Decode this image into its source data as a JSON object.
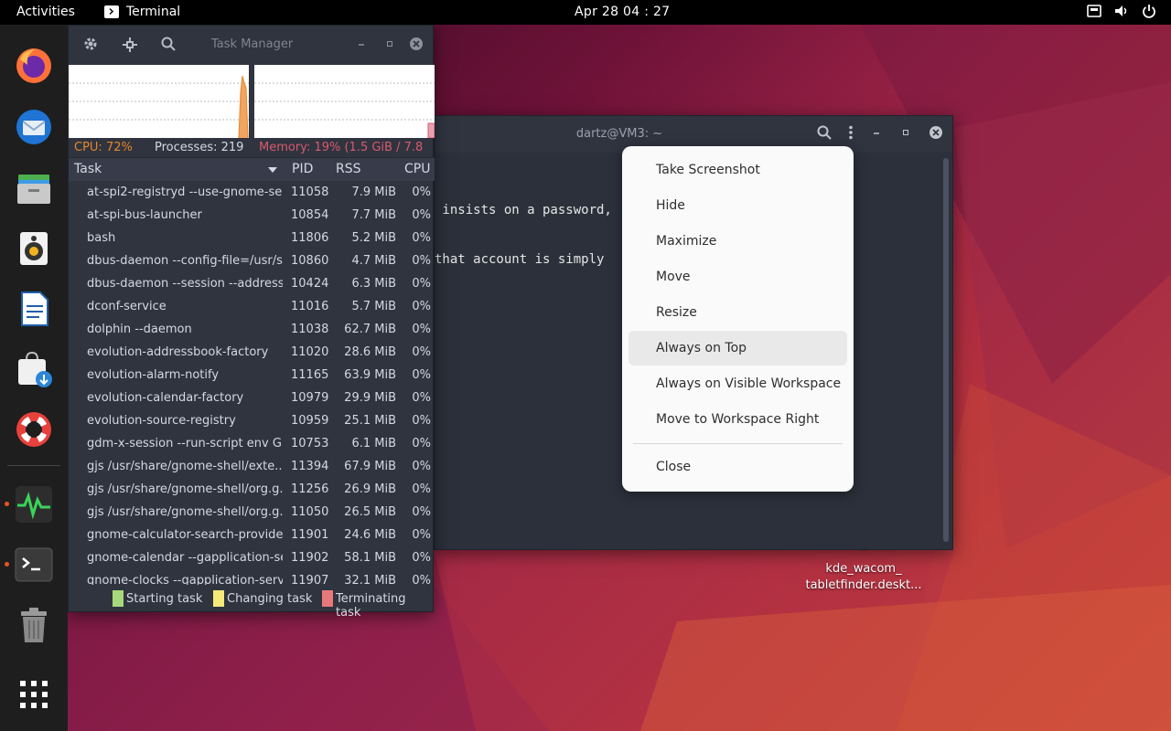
{
  "topbar": {
    "activities": "Activities",
    "app_name": "Terminal",
    "clock": "Apr 28  04 : 27"
  },
  "dock": {
    "items": [
      "firefox-icon",
      "thunderbird-icon",
      "files-icon",
      "rhythmbox-icon",
      "writer-icon",
      "software-icon",
      "help-icon",
      "system-monitor-icon",
      "terminal-icon",
      "trash-icon",
      "show-apps-icon"
    ]
  },
  "taskmanager": {
    "title": "Task Manager",
    "cpu": "CPU: 72%",
    "processes": "Processes: 219",
    "memory": "Memory: 19% (1.5 GiB / 7.8",
    "columns": {
      "task": "Task",
      "pid": "PID",
      "rss": "RSS",
      "cpu": "CPU"
    },
    "rows": [
      {
        "task": "at-spi2-registryd --use-gnome-se...",
        "pid": "11058",
        "rss": "7.9 MiB",
        "cpu": "0%"
      },
      {
        "task": "at-spi-bus-launcher",
        "pid": "10854",
        "rss": "7.7 MiB",
        "cpu": "0%"
      },
      {
        "task": "bash",
        "pid": "11806",
        "rss": "5.2 MiB",
        "cpu": "0%"
      },
      {
        "task": "dbus-daemon --config-file=/usr/s...",
        "pid": "10860",
        "rss": "4.7 MiB",
        "cpu": "0%"
      },
      {
        "task": "dbus-daemon --session --address...",
        "pid": "10424",
        "rss": "6.3 MiB",
        "cpu": "0%"
      },
      {
        "task": "dconf-service",
        "pid": "11016",
        "rss": "5.7 MiB",
        "cpu": "0%"
      },
      {
        "task": "dolphin --daemon",
        "pid": "11038",
        "rss": "62.7 MiB",
        "cpu": "0%"
      },
      {
        "task": "evolution-addressbook-factory",
        "pid": "11020",
        "rss": "28.6 MiB",
        "cpu": "0%"
      },
      {
        "task": "evolution-alarm-notify",
        "pid": "11165",
        "rss": "63.9 MiB",
        "cpu": "0%"
      },
      {
        "task": "evolution-calendar-factory",
        "pid": "10979",
        "rss": "29.9 MiB",
        "cpu": "0%"
      },
      {
        "task": "evolution-source-registry",
        "pid": "10959",
        "rss": "25.1 MiB",
        "cpu": "0%"
      },
      {
        "task": "gdm-x-session --run-script env G...",
        "pid": "10753",
        "rss": "6.1 MiB",
        "cpu": "0%"
      },
      {
        "task": "gjs /usr/share/gnome-shell/exte...",
        "pid": "11394",
        "rss": "67.9 MiB",
        "cpu": "0%"
      },
      {
        "task": "gjs /usr/share/gnome-shell/org.g...",
        "pid": "11256",
        "rss": "26.9 MiB",
        "cpu": "0%"
      },
      {
        "task": "gjs /usr/share/gnome-shell/org.g...",
        "pid": "11050",
        "rss": "26.5 MiB",
        "cpu": "0%"
      },
      {
        "task": "gnome-calculator-search-provider",
        "pid": "11901",
        "rss": "24.6 MiB",
        "cpu": "0%"
      },
      {
        "task": "gnome-calendar --gapplication-se...",
        "pid": "11902",
        "rss": "58.1 MiB",
        "cpu": "0%"
      },
      {
        "task": "gnome-clocks --gapplication-servi...",
        "pid": "11907",
        "rss": "32.1 MiB",
        "cpu": "0%"
      }
    ],
    "legend": [
      {
        "label": "Starting task",
        "color": "#a8d87c"
      },
      {
        "label": "Changing task",
        "color": "#f5e97a"
      },
      {
        "label": "Terminating task",
        "color": "#e8797a"
      }
    ],
    "colors": {
      "cpu": "#e8852a",
      "memory": "#d9596d"
    }
  },
  "terminal": {
    "title": "dartz@VM3: ~",
    "lines": [
      " insists on a password,",
      "that account is simply"
    ]
  },
  "context_menu": {
    "items": [
      "Take Screenshot",
      "Hide",
      "Maximize",
      "Move",
      "Resize",
      "Always on Top",
      "Always on Visible Workspace",
      "Move to Workspace Right"
    ],
    "close": "Close",
    "highlighted": "Always on Top"
  },
  "desktop_file": {
    "line1": "kde_wacom_",
    "line2": "tabletfinder.deskt..."
  }
}
